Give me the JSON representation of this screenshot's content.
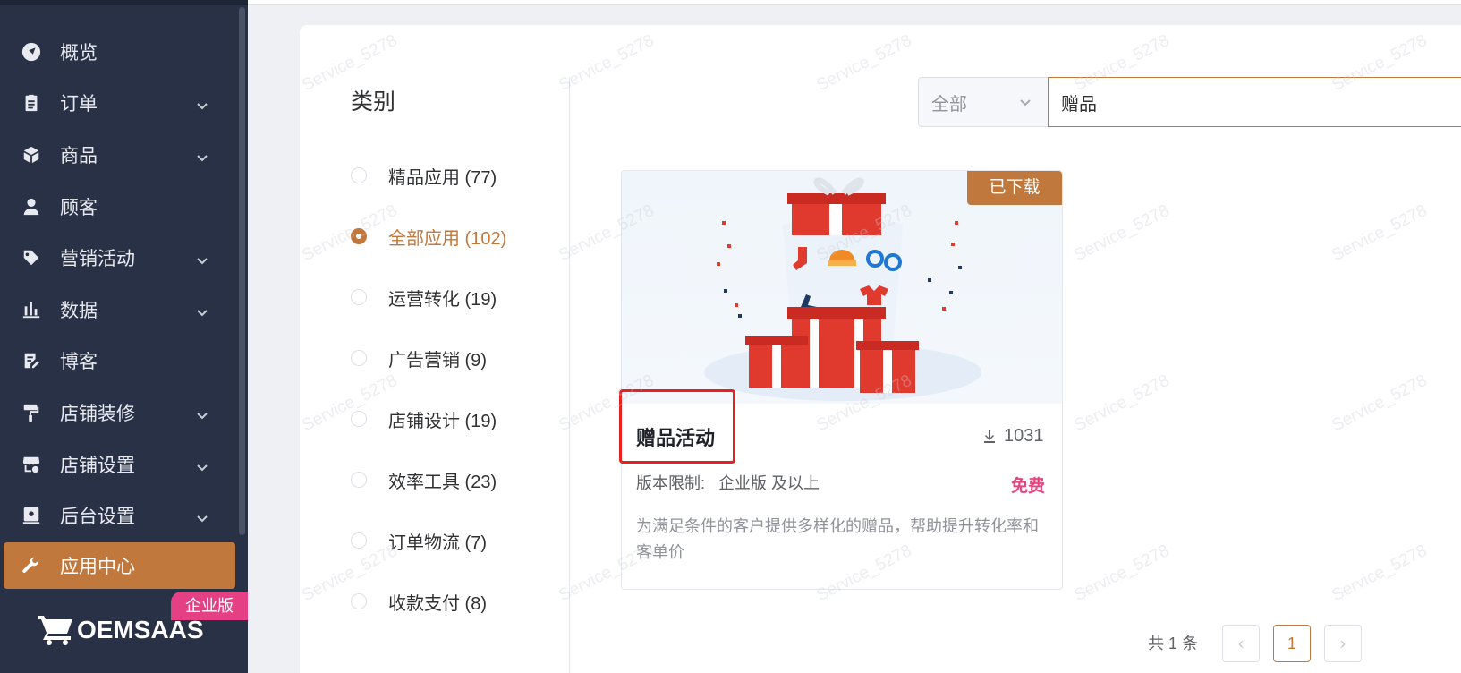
{
  "sidebar": {
    "items": [
      {
        "label": "概览",
        "icon": "compass-icon",
        "has_children": false,
        "active": false
      },
      {
        "label": "订单",
        "icon": "clipboard-icon",
        "has_children": true,
        "active": false
      },
      {
        "label": "商品",
        "icon": "box-icon",
        "has_children": true,
        "active": false
      },
      {
        "label": "顾客",
        "icon": "user-icon",
        "has_children": false,
        "active": false
      },
      {
        "label": "营销活动",
        "icon": "tag-icon",
        "has_children": true,
        "active": false
      },
      {
        "label": "数据",
        "icon": "bar-chart-icon",
        "has_children": true,
        "active": false
      },
      {
        "label": "博客",
        "icon": "edit-note-icon",
        "has_children": false,
        "active": false
      },
      {
        "label": "店铺装修",
        "icon": "paint-roller-icon",
        "has_children": true,
        "active": false
      },
      {
        "label": "店铺设置",
        "icon": "store-settings-icon",
        "has_children": true,
        "active": false
      },
      {
        "label": "后台设置",
        "icon": "admin-settings-icon",
        "has_children": true,
        "active": false
      },
      {
        "label": "应用中心",
        "icon": "wrench-icon",
        "has_children": false,
        "active": true
      }
    ],
    "edition_badge": "企业版",
    "brand": "OEMSAAS"
  },
  "categories": {
    "title": "类别",
    "items": [
      {
        "label": "精品应用 (77)",
        "checked": false
      },
      {
        "label": "全部应用 (102)",
        "checked": true
      },
      {
        "label": "运营转化 (19)",
        "checked": false
      },
      {
        "label": "广告营销 (9)",
        "checked": false
      },
      {
        "label": "店铺设计 (19)",
        "checked": false
      },
      {
        "label": "效率工具 (23)",
        "checked": false
      },
      {
        "label": "订单物流 (7)",
        "checked": false
      },
      {
        "label": "收款支付 (8)",
        "checked": false
      }
    ]
  },
  "search": {
    "scope_value": "全部",
    "query": "赠品"
  },
  "app_card": {
    "status_badge": "已下载",
    "title": "赠品活动",
    "downloads": "1031",
    "version_label": "版本限制:",
    "version_value": "企业版 及以上",
    "price": "免费",
    "description": "为满足条件的客户提供多样化的赠品，帮助提升转化率和客单价"
  },
  "pagination": {
    "total": "共 1 条",
    "prev": "‹",
    "current": "1",
    "next": "›"
  },
  "watermark": "Service_5278",
  "colors": {
    "sidebar_bg": "#283146",
    "accent": "#c0783c",
    "price": "#e5457f",
    "badge": "#e54083",
    "highlight": "#e8201f"
  }
}
